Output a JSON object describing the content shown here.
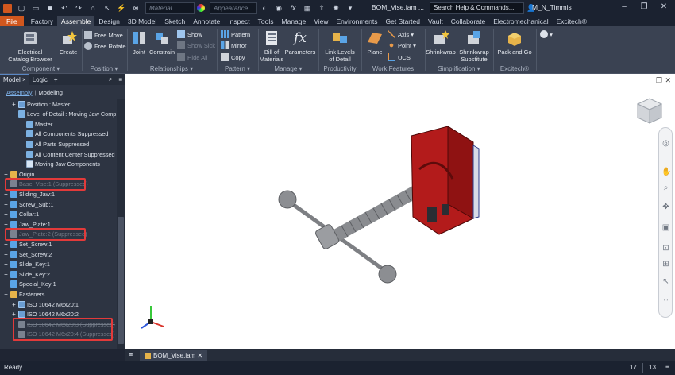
{
  "titlebar": {
    "material_placeholder": "Material",
    "appearance_placeholder": "Appearance",
    "doc_title": "BOM_Vise.iam ...",
    "search_placeholder": "Search Help & Commands...",
    "user": "M_N_Timmis"
  },
  "tabs": [
    "File",
    "Factory",
    "Assemble",
    "Design",
    "3D Model",
    "Sketch",
    "Annotate",
    "Inspect",
    "Tools",
    "Manage",
    "View",
    "Environments",
    "Get Started",
    "Vault",
    "Collaborate",
    "Electromechanical",
    "Excitech®"
  ],
  "active_tab": "Assemble",
  "ribbon": {
    "component": {
      "title": "Component ▾",
      "electrical": "Electrical",
      "catalog": "Catalog Browser",
      "create": "Create"
    },
    "position": {
      "title": "Position ▾",
      "free_move": "Free Move",
      "free_rotate": "Free Rotate"
    },
    "relationships": {
      "title": "Relationships ▾",
      "joint": "Joint",
      "constrain": "Constrain",
      "show": "Show",
      "show_sick": "Show Sick",
      "hide_all": "Hide All"
    },
    "pattern": {
      "title": "Pattern ▾",
      "pattern": "Pattern",
      "mirror": "Mirror",
      "copy": "Copy"
    },
    "manage": {
      "title": "Manage ▾",
      "bom1": "Bill of",
      "bom2": "Materials",
      "parameters": "Parameters"
    },
    "productivity": {
      "title": "Productivity",
      "link1": "Link Levels",
      "link2": "of Detail"
    },
    "work_features": {
      "title": "Work Features",
      "plane": "Plane",
      "axis": "Axis ▾",
      "point": "Point ▾",
      "ucs": "UCS"
    },
    "simplification": {
      "title": "Simplification ▾",
      "shrinkwrap": "Shrinkwrap",
      "shrinkwrap_sub1": "Shrinkwrap",
      "shrinkwrap_sub2": "Substitute"
    },
    "excitech": {
      "title": "Excitech®",
      "pack1": "Pack and Go"
    }
  },
  "browser": {
    "tab_model": "Model",
    "tab_logic": "Logic",
    "sub_assembly": "Assembly",
    "sub_modeling": "Modeling",
    "nodes": [
      {
        "label": "Position : Master",
        "exp": "+",
        "icon": "asm",
        "indent": 1,
        "sup": false
      },
      {
        "label": "Level of Detail : Moving Jaw Compor",
        "exp": "−",
        "icon": "lod",
        "indent": 1,
        "sup": false
      },
      {
        "label": "Master",
        "exp": "",
        "icon": "lod",
        "indent": 2,
        "sup": false
      },
      {
        "label": "All Components Suppressed",
        "exp": "",
        "icon": "lod",
        "indent": 2,
        "sup": false
      },
      {
        "label": "All Parts Suppressed",
        "exp": "",
        "icon": "lod",
        "indent": 2,
        "sup": false
      },
      {
        "label": "All Content Center Suppressed",
        "exp": "",
        "icon": "lod",
        "indent": 2,
        "sup": false
      },
      {
        "label": "Moving Jaw Components",
        "exp": "",
        "icon": "check",
        "indent": 2,
        "sup": false
      },
      {
        "label": "Origin",
        "exp": "+",
        "icon": "folder",
        "indent": 0,
        "sup": false
      },
      {
        "label": "Base_Vise:1 (Suppressed)",
        "exp": "+",
        "icon": "sup",
        "indent": 0,
        "sup": true
      },
      {
        "label": "Sliding_Jaw:1",
        "exp": "+",
        "icon": "part",
        "indent": 0,
        "sup": false
      },
      {
        "label": "Screw_Sub:1",
        "exp": "+",
        "icon": "part",
        "indent": 0,
        "sup": false
      },
      {
        "label": "Collar:1",
        "exp": "+",
        "icon": "part",
        "indent": 0,
        "sup": false
      },
      {
        "label": "Jaw_Plate:1",
        "exp": "+",
        "icon": "part",
        "indent": 0,
        "sup": false
      },
      {
        "label": "Jaw_Plate:2 (Suppressed)",
        "exp": "+",
        "icon": "sup",
        "indent": 0,
        "sup": true
      },
      {
        "label": "Set_Screw:1",
        "exp": "+",
        "icon": "part",
        "indent": 0,
        "sup": false
      },
      {
        "label": "Set_Screw:2",
        "exp": "+",
        "icon": "part",
        "indent": 0,
        "sup": false
      },
      {
        "label": "Slide_Key:1",
        "exp": "+",
        "icon": "part",
        "indent": 0,
        "sup": false
      },
      {
        "label": "Slide_Key:2",
        "exp": "+",
        "icon": "part",
        "indent": 0,
        "sup": false
      },
      {
        "label": "Special_Key:1",
        "exp": "+",
        "icon": "part",
        "indent": 0,
        "sup": false
      },
      {
        "label": "Fasteners",
        "exp": "−",
        "icon": "folder",
        "indent": 0,
        "sup": false
      },
      {
        "label": "ISO 10642 M6x20:1",
        "exp": "+",
        "icon": "asm",
        "indent": 1,
        "sup": false
      },
      {
        "label": "ISO 10642 M6x20:2",
        "exp": "+",
        "icon": "asm",
        "indent": 1,
        "sup": false
      },
      {
        "label": "ISO 10642 M6x20:3 (Suppressed)",
        "exp": "",
        "icon": "sup",
        "indent": 1,
        "sup": true
      },
      {
        "label": "ISO 10642 M6x20:4 (Suppressed)",
        "exp": "",
        "icon": "sup",
        "indent": 1,
        "sup": true
      }
    ]
  },
  "doc_tab": "BOM_Vise.iam",
  "status": {
    "ready": "Ready",
    "n1": "17",
    "n2": "13"
  },
  "colors": {
    "accent": "#d1571e",
    "highlight": "#e23a3a",
    "jaw": "#b31b1b"
  }
}
